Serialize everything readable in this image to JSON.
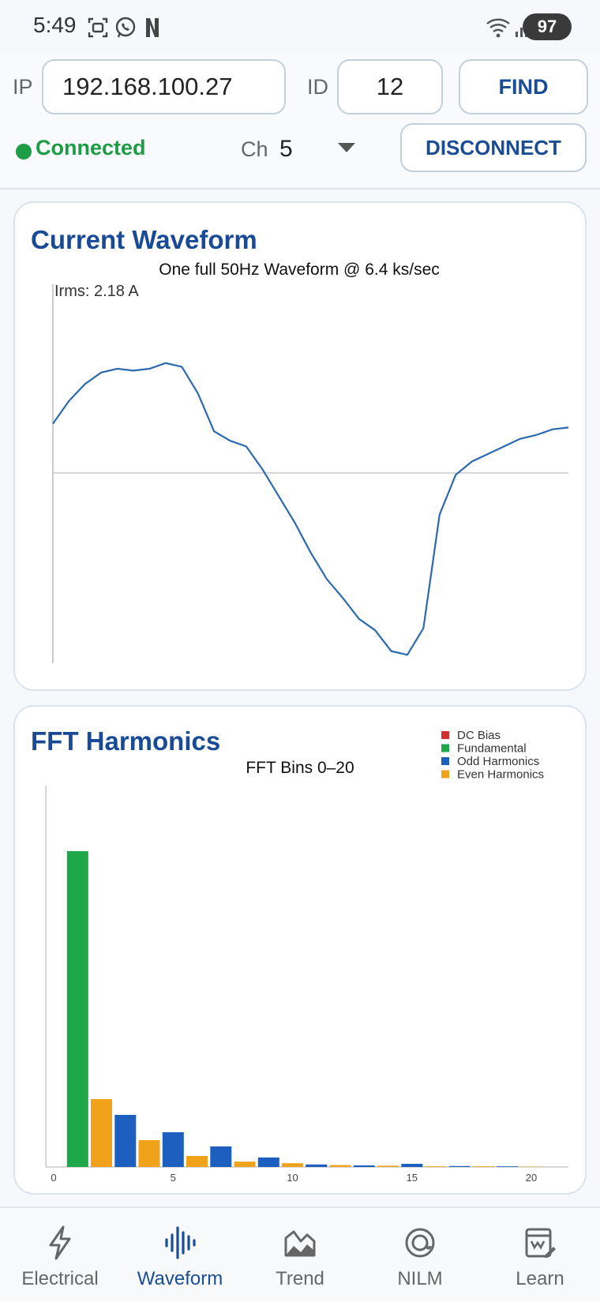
{
  "status_bar": {
    "time": "5:49",
    "battery": "97"
  },
  "connection": {
    "ip_label": "IP",
    "ip_value": "192.168.100.27",
    "id_label": "ID",
    "id_value": "12",
    "find_label": "FIND",
    "status": "Connected",
    "channel_label": "Ch",
    "channel_value": "5",
    "disconnect_label": "DISCONNECT",
    "colors": {
      "connected": "#1d9d43",
      "button_text": "#1a4d96"
    }
  },
  "waveform_card": {
    "title": "Current Waveform",
    "subtitle": "One full 50Hz Waveform @ 6.4 ks/sec",
    "irms": "Irms: 2.18 A",
    "line_color": "#2a6aad"
  },
  "chart_data": [
    {
      "type": "line",
      "title": "One full 50Hz Waveform @ 6.4 ks/sec",
      "annotation": "Irms: 2.18 A",
      "x": [
        0,
        4,
        8,
        12,
        16,
        20,
        24,
        28,
        32,
        36,
        40,
        44,
        48,
        52,
        56,
        60,
        64,
        68,
        72,
        76,
        80,
        84,
        88,
        92,
        96,
        100,
        104,
        108,
        112,
        116,
        120,
        124,
        128
      ],
      "y": [
        0.26,
        0.38,
        0.47,
        0.53,
        0.55,
        0.54,
        0.55,
        0.58,
        0.56,
        0.42,
        0.22,
        0.17,
        0.14,
        0.02,
        -0.12,
        -0.26,
        -0.42,
        -0.56,
        -0.66,
        -0.77,
        -0.83,
        -0.94,
        -0.96,
        -0.82,
        -0.22,
        -0.01,
        0.06,
        0.1,
        0.14,
        0.18,
        0.2,
        0.23,
        0.24
      ],
      "ylim": [
        -1,
        1
      ],
      "grid": false,
      "legend": "none"
    },
    {
      "type": "bar",
      "title": "FFT Bins 0–20",
      "categories": [
        0,
        1,
        2,
        3,
        4,
        5,
        6,
        7,
        8,
        9,
        10,
        11,
        12,
        13,
        14,
        15,
        16,
        17,
        18,
        19,
        20
      ],
      "values": [
        0,
        100,
        21.5,
        16.5,
        8.5,
        11.0,
        3.5,
        6.5,
        1.7,
        3.0,
        1.2,
        0.8,
        0.6,
        0.5,
        0.4,
        1.0,
        0.2,
        0.3,
        0.2,
        0.2,
        0.1
      ],
      "bar_classes": [
        "dc",
        "fundamental",
        "even",
        "odd",
        "even",
        "odd",
        "even",
        "odd",
        "even",
        "odd",
        "even",
        "odd",
        "even",
        "odd",
        "even",
        "odd",
        "even",
        "odd",
        "even",
        "odd",
        "even"
      ],
      "x_ticks": [
        "0",
        "5",
        "10",
        "15",
        "20"
      ],
      "ylim": [
        0,
        100
      ],
      "legend": "top-right",
      "series": [
        {
          "name": "DC Bias",
          "key": "dc",
          "color": "#d42f2f"
        },
        {
          "name": "Fundamental",
          "key": "fundamental",
          "color": "#1fa84a"
        },
        {
          "name": "Odd Harmonics",
          "key": "odd",
          "color": "#1c5fbf"
        },
        {
          "name": "Even Harmonics",
          "key": "even",
          "color": "#f0a21b"
        }
      ]
    }
  ],
  "fft_card": {
    "title": "FFT Harmonics",
    "subtitle": "FFT Bins 0–20"
  },
  "bottom_nav": {
    "items": [
      {
        "label": "Electrical",
        "icon": "lightning-icon"
      },
      {
        "label": "Waveform",
        "icon": "waveform-icon",
        "active": true
      },
      {
        "label": "Trend",
        "icon": "trend-icon"
      },
      {
        "label": "NILM",
        "icon": "target-icon"
      },
      {
        "label": "Learn",
        "icon": "learn-icon"
      }
    ],
    "active_color": "#1a4d96"
  }
}
